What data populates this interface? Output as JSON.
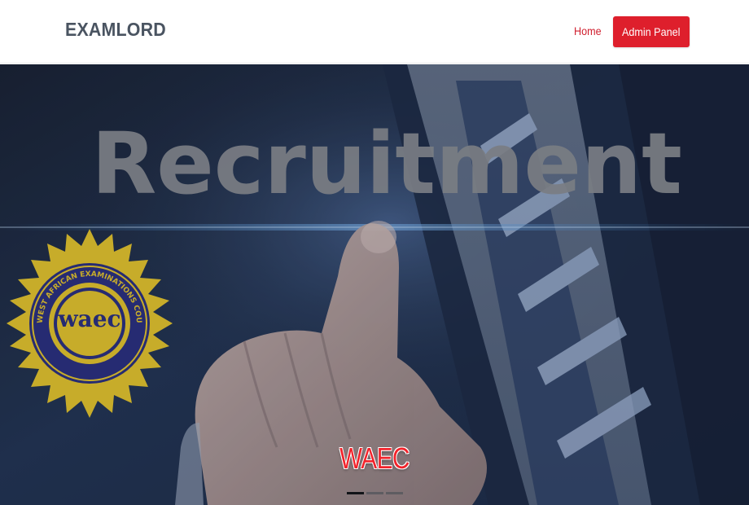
{
  "navbar": {
    "brand": "EXAMLORD",
    "home_label": "Home",
    "admin_label": "Admin Panel"
  },
  "hero": {
    "image_text": "Recruitment",
    "seal_text": "THE WEST AFRICAN EXAMINATIONS COUNCIL",
    "seal_monogram": "waec",
    "caption": "WAEC",
    "indicators": [
      {
        "active": true
      },
      {
        "active": false
      },
      {
        "active": false
      }
    ]
  },
  "colors": {
    "brand_text": "#4a5461",
    "accent_red": "#de1f2c",
    "caption_red": "#f2232b",
    "seal_yellow": "#e2c22c",
    "seal_blue": "#2b2f7e",
    "hero_dark": "#1b2537"
  },
  "icons": [
    "waec-seal-icon"
  ]
}
